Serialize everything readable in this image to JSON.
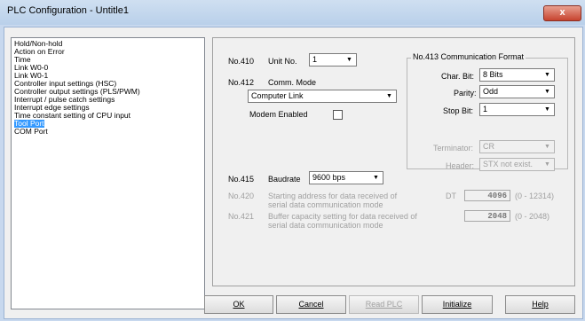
{
  "window": {
    "title": "PLC Configuration - Untitle1",
    "close_label": "x"
  },
  "sidebar": {
    "items": [
      {
        "label": "Hold/Non-hold"
      },
      {
        "label": "Action on Error"
      },
      {
        "label": "Time"
      },
      {
        "label": "Link W0-0"
      },
      {
        "label": "Link W0-1"
      },
      {
        "label": "Controller input settings (HSC)"
      },
      {
        "label": "Controller output settings (PLS/PWM)"
      },
      {
        "label": "Interrupt / pulse catch settings"
      },
      {
        "label": "Interrupt edge settings"
      },
      {
        "label": "Time constant setting of CPU input"
      },
      {
        "label": "Tool Port",
        "selected": true
      },
      {
        "label": "COM Port"
      }
    ]
  },
  "settings": {
    "unit_no": {
      "code": "No.410",
      "label": "Unit No.",
      "value": "1"
    },
    "comm_mode": {
      "code": "No.412",
      "label": "Comm. Mode",
      "value": "Computer Link"
    },
    "modem": {
      "label": "Modem Enabled",
      "checked": false
    },
    "comm_format": {
      "title": "No.413 Communication Format",
      "char_bit": {
        "label": "Char. Bit:",
        "value": "8 Bits"
      },
      "parity": {
        "label": "Parity:",
        "value": "Odd"
      },
      "stop_bit": {
        "label": "Stop Bit:",
        "value": "1"
      },
      "terminator": {
        "label": "Terminator:",
        "value": "CR"
      },
      "header": {
        "label": "Header:",
        "value": "STX not exist."
      }
    },
    "baudrate": {
      "code": "No.415",
      "label": "Baudrate",
      "value": "9600 bps"
    },
    "start_addr": {
      "code": "No.420",
      "line1": "Starting address for data received of",
      "line2": "serial data communication mode",
      "prefix": "DT",
      "value": "4096",
      "range": "(0 - 12314)"
    },
    "buffer_cap": {
      "code": "No.421",
      "line1": "Buffer capacity setting for data received of",
      "line2": "serial data communication mode",
      "value": "2048",
      "range": "(0 - 2048)"
    }
  },
  "buttons": {
    "ok": "OK",
    "cancel": "Cancel",
    "read_plc": "Read PLC",
    "initialize": "Initialize",
    "help": "Help"
  },
  "icons": {
    "dropdown": "chevron-down-icon"
  }
}
